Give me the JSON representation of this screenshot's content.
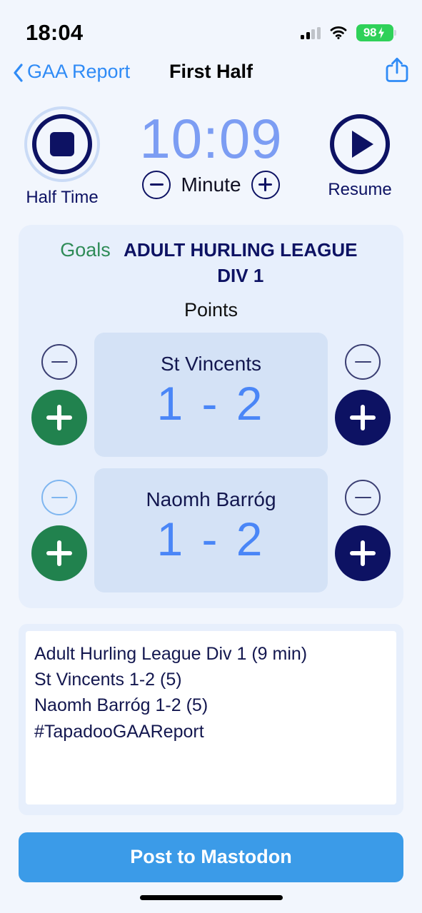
{
  "status_bar": {
    "time": "18:04",
    "battery_percent": "98",
    "icons": {
      "signal": "cellular-signal-icon",
      "wifi": "wifi-icon",
      "battery": "battery-charging-icon"
    }
  },
  "nav": {
    "back_label": "GAA Report",
    "title": "First Half",
    "share_icon": "share-icon",
    "back_icon": "chevron-left-icon"
  },
  "timer": {
    "halftime_label": "Half Time",
    "halftime_icon": "stop-icon",
    "display": "10:09",
    "minute_label": "Minute",
    "minute_minus_icon": "minus-circle-icon",
    "minute_plus_icon": "plus-circle-icon",
    "resume_label": "Resume",
    "resume_icon": "play-icon"
  },
  "scoreboard": {
    "goals_label": "Goals",
    "points_label": "Points",
    "competition": "ADULT HURLING LEAGUE DIV 1",
    "teams": [
      {
        "name": "St Vincents",
        "score": "1 - 2",
        "goals_minus_icon": "minus-circle-icon",
        "goals_plus_icon": "plus-circle-icon",
        "points_minus_icon": "minus-circle-icon",
        "points_plus_icon": "plus-circle-icon"
      },
      {
        "name": "Naomh Barróg",
        "score": "1 - 2",
        "goals_minus_icon": "minus-circle-icon",
        "goals_plus_icon": "plus-circle-icon",
        "points_minus_icon": "minus-circle-icon",
        "points_plus_icon": "plus-circle-icon"
      }
    ]
  },
  "report": {
    "text": "Adult Hurling League Div 1 (9 min)\nSt Vincents 1-2 (5)\nNaomh Barróg 1-2 (5)\n#TapadooGAAReport"
  },
  "post_button": {
    "label": "Post to Mastodon"
  },
  "colors": {
    "background": "#F2F6FD",
    "panel": "#E7EFFC",
    "card": "#D4E2F6",
    "navy": "#0D1263",
    "green": "#21824E",
    "accent_blue": "#2F8BF6",
    "score_blue": "#4A86F7",
    "timer_blue": "#7C9DF3",
    "mastodon_blue": "#3B9BE8",
    "battery_green": "#2FD159"
  }
}
